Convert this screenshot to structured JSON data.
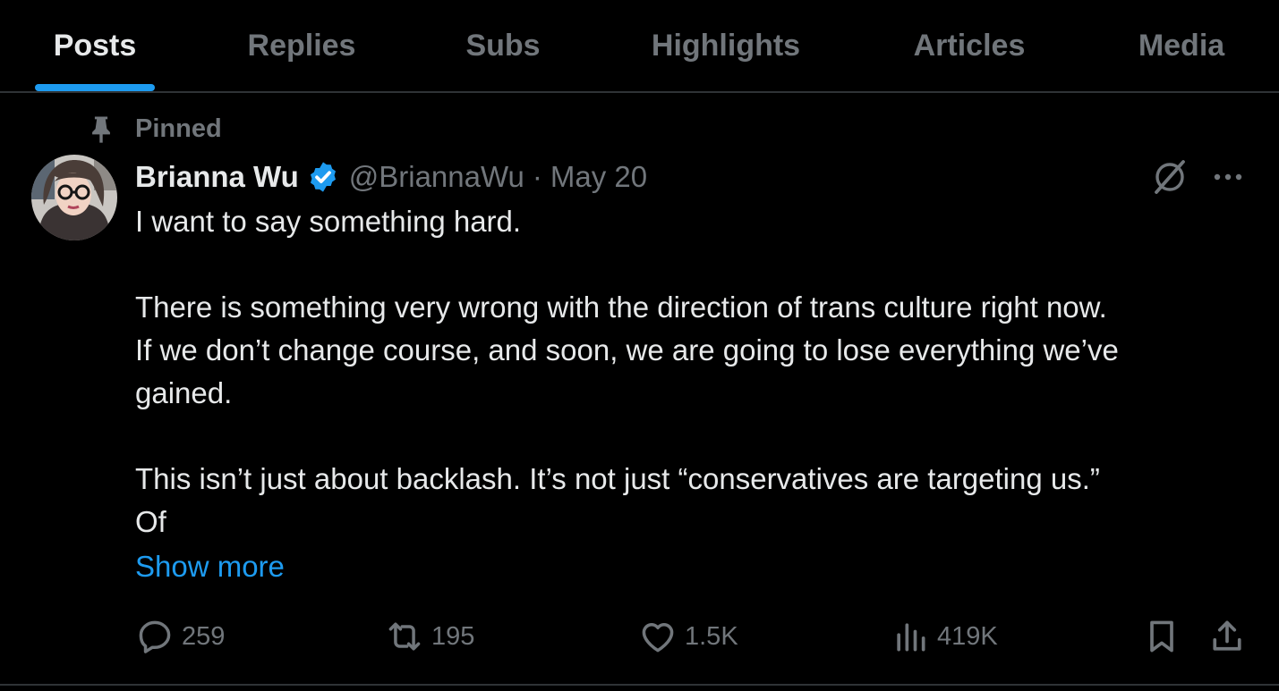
{
  "tabs": [
    {
      "label": "Posts"
    },
    {
      "label": "Replies"
    },
    {
      "label": "Subs"
    },
    {
      "label": "Highlights"
    },
    {
      "label": "Articles"
    },
    {
      "label": "Media"
    }
  ],
  "active_tab": "Posts",
  "post": {
    "pinned_label": "Pinned",
    "author_name": "Brianna Wu",
    "handle": "@BriannaWu",
    "separator": "·",
    "date": "May 20",
    "body": [
      "I want to say something hard.",
      "",
      "There is something very wrong with the direction of trans culture right now.",
      "If we don’t change course, and soon, we are going to lose everything we’ve",
      "gained.",
      "",
      "This isn’t just about backlash. It’s not just “conservatives are targeting us.”",
      "Of"
    ],
    "show_more": "Show more",
    "stats": {
      "replies": "259",
      "reposts": "195",
      "likes": "1.5K",
      "views": "419K"
    }
  },
  "colors": {
    "background": "#000000",
    "text": "#e7e9ea",
    "muted": "#71767b",
    "accent": "#1d9bf0",
    "divider": "#2f3336"
  },
  "icons": [
    "pin-icon",
    "verified-badge-icon",
    "grok-icon",
    "more-icon",
    "reply-icon",
    "repost-icon",
    "like-icon",
    "views-icon",
    "bookmark-icon",
    "share-icon"
  ]
}
